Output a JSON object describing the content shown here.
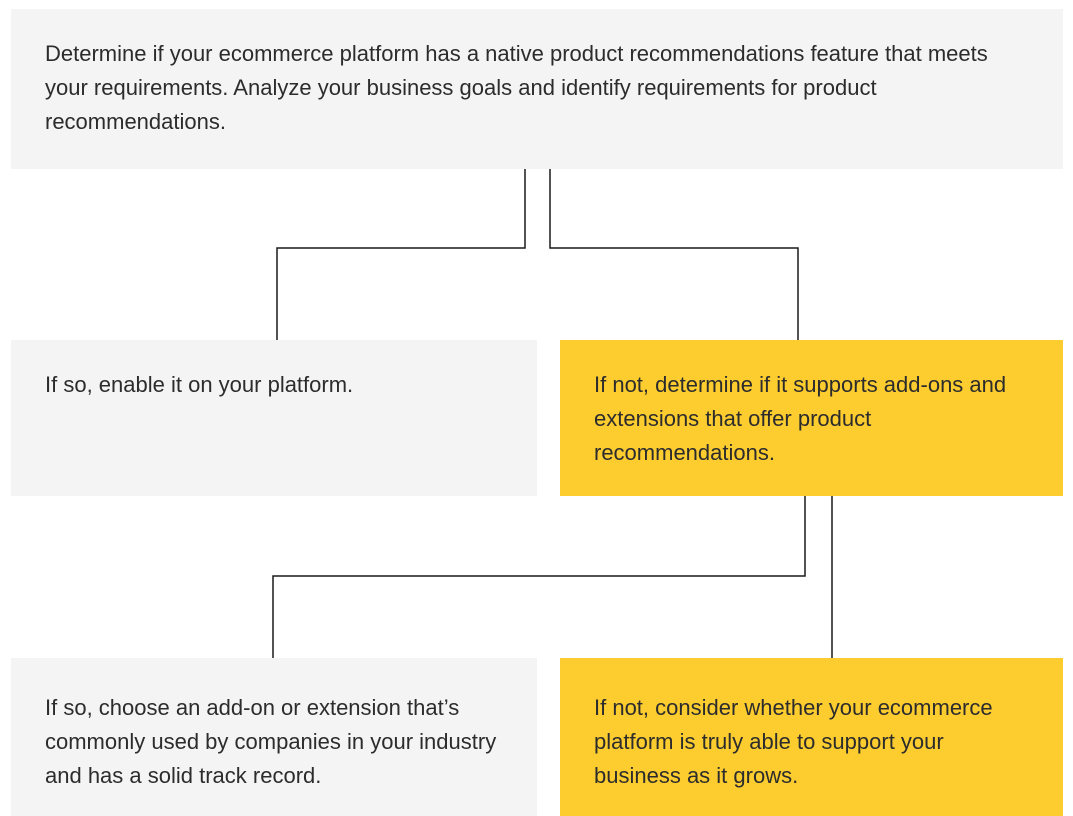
{
  "nodes": {
    "top": "Determine if your ecommerce platform has a native product recommendations feature that meets your requirements. Analyze your business goals and identify requirements for product recommendations.",
    "yes_native": "If so, enable it on your platform.",
    "no_native": "If not, determine if it supports add-ons and extensions that offer product recommendations.",
    "yes_addon": "If so, choose an add-on or extension that’s commonly used by companies in your industry and has a solid track record.",
    "no_addon": "If not, consider whether your ecommerce platform is truly able to support your business as it grows."
  },
  "colors": {
    "neutral_box": "#f4f4f4",
    "highlight_box": "#fdcd30",
    "connector": "#1a1a1a",
    "text": "#2c2c2c"
  }
}
